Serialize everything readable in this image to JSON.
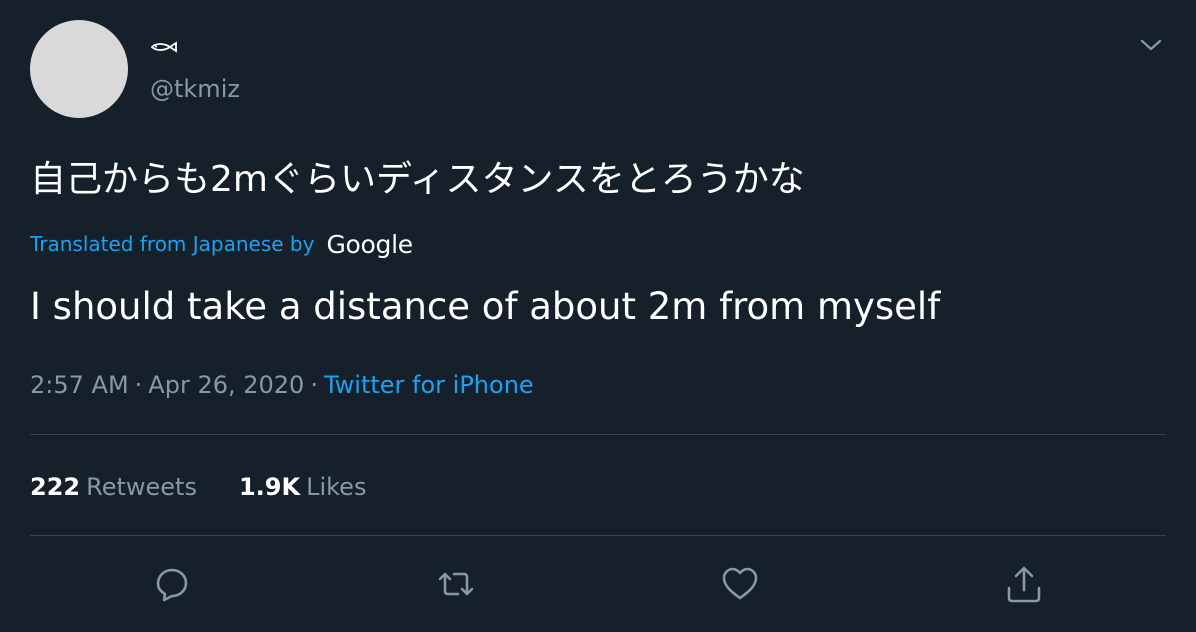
{
  "user": {
    "handle": "@tkmiz"
  },
  "tweet": {
    "text": "自己からも2mぐらいディスタンスをとろうかな",
    "translated_label": "Translated from Japanese by",
    "translator": "Google",
    "translation": "I should take a distance of about 2m from myself",
    "time": "2:57 AM",
    "separator": "·",
    "date": "Apr 26, 2020",
    "source": "Twitter for iPhone"
  },
  "stats": {
    "retweets_count": "222",
    "retweets_label": "Retweets",
    "likes_count": "1.9K",
    "likes_label": "Likes"
  },
  "icons": {
    "display_name_icon": "fish-icon",
    "menu": "chevron-down-icon",
    "reply": "reply-icon",
    "retweet": "retweet-icon",
    "like": "heart-icon",
    "share": "share-icon"
  },
  "colors": {
    "background": "#15202b",
    "accent": "#1da1f2",
    "secondary_text": "#8899a6",
    "divider": "#38444d"
  }
}
